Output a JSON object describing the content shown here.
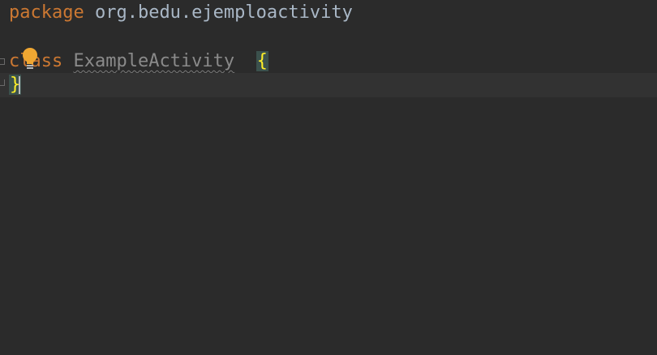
{
  "editor": {
    "line1": {
      "keyword": "package",
      "name": "org.bedu.ejemploactivity"
    },
    "line3": {
      "keyword": "class",
      "class_name": "ExampleActivity",
      "spacer": "  ",
      "open_brace": "{"
    },
    "line4": {
      "close_brace": "}"
    }
  },
  "icons": {
    "intention": "lightbulb-icon",
    "fold": "fold-marker-icon"
  },
  "colors": {
    "background": "#2b2b2b",
    "current_line": "#323232",
    "keyword": "#cc7832",
    "text": "#a9b7c6",
    "brace_match": "#ffef28",
    "bulb": "#f0a732"
  }
}
